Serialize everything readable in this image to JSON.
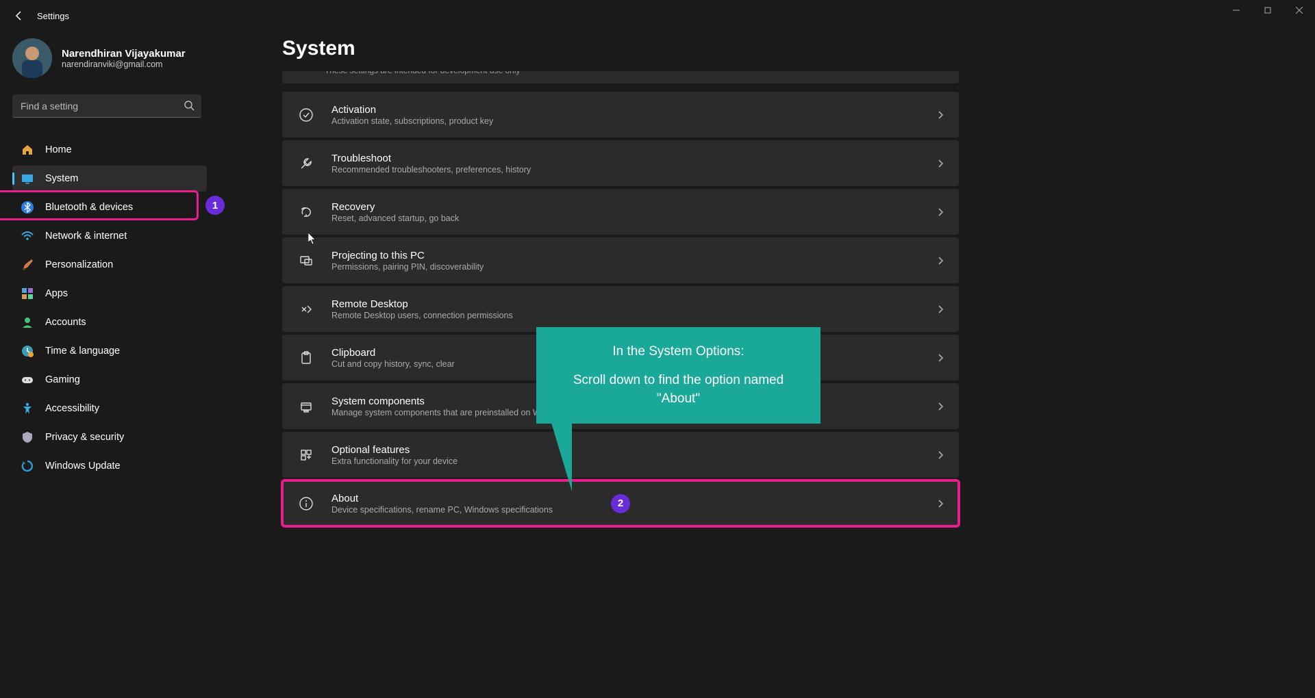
{
  "window": {
    "title": "Settings"
  },
  "user": {
    "name": "Narendhiran Vijayakumar",
    "email": "narendiranviki@gmail.com"
  },
  "search": {
    "placeholder": "Find a setting"
  },
  "nav": {
    "items": [
      {
        "label": "Home",
        "icon": "home"
      },
      {
        "label": "System",
        "icon": "system",
        "selected": true
      },
      {
        "label": "Bluetooth & devices",
        "icon": "bluetooth"
      },
      {
        "label": "Network & internet",
        "icon": "network"
      },
      {
        "label": "Personalization",
        "icon": "brush"
      },
      {
        "label": "Apps",
        "icon": "apps"
      },
      {
        "label": "Accounts",
        "icon": "accounts"
      },
      {
        "label": "Time & language",
        "icon": "time"
      },
      {
        "label": "Gaming",
        "icon": "gaming"
      },
      {
        "label": "Accessibility",
        "icon": "accessibility"
      },
      {
        "label": "Privacy & security",
        "icon": "privacy"
      },
      {
        "label": "Windows Update",
        "icon": "update"
      }
    ]
  },
  "page": {
    "title": "System",
    "partial_hint": "These settings are intended for development use only",
    "items": [
      {
        "title": "Activation",
        "desc": "Activation state, subscriptions, product key",
        "icon": "check"
      },
      {
        "title": "Troubleshoot",
        "desc": "Recommended troubleshooters, preferences, history",
        "icon": "wrench"
      },
      {
        "title": "Recovery",
        "desc": "Reset, advanced startup, go back",
        "icon": "recovery"
      },
      {
        "title": "Projecting to this PC",
        "desc": "Permissions, pairing PIN, discoverability",
        "icon": "project"
      },
      {
        "title": "Remote Desktop",
        "desc": "Remote Desktop users, connection permissions",
        "icon": "remote"
      },
      {
        "title": "Clipboard",
        "desc": "Cut and copy history, sync, clear",
        "icon": "clipboard"
      },
      {
        "title": "System components",
        "desc": "Manage system components that are preinstalled on Windows",
        "icon": "components"
      },
      {
        "title": "Optional features",
        "desc": "Extra functionality for your device",
        "icon": "features"
      },
      {
        "title": "About",
        "desc": "Device specifications, rename PC, Windows specifications",
        "icon": "info",
        "highlight": true
      }
    ]
  },
  "annotations": {
    "badge1": "1",
    "badge2": "2",
    "callout_line1": "In the System Options:",
    "callout_line2": "Scroll down to find the option named \"About\""
  }
}
